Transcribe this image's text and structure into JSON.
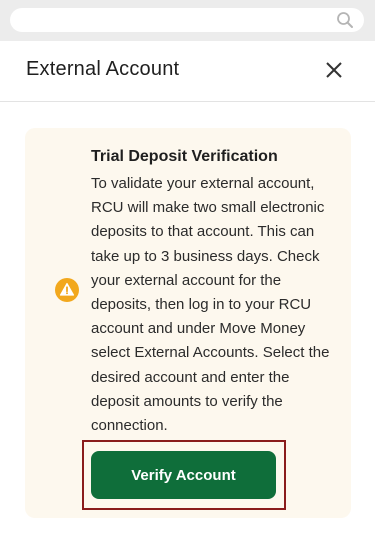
{
  "search": {
    "icon": "search-icon",
    "placeholder": ""
  },
  "header": {
    "title": "External Account",
    "close_icon": "close-icon"
  },
  "notice": {
    "icon": "warning-icon",
    "title": "Trial Deposit Verification",
    "body": "To validate your external account, RCU will make two small electronic deposits to that account. This can take up to 3 business days. Check your external account for the deposits, then log in to your RCU account and under Move Money select External Accounts. Select the desired account and enter the deposit amounts to verify the connection."
  },
  "actions": {
    "verify_label": "Verify Account"
  },
  "colors": {
    "top_bar": "#ececec",
    "card_background": "#fdf8ee",
    "warning": "#f2a81d",
    "button": "#0f6e3a",
    "highlight_outline": "#8a1c1c"
  }
}
